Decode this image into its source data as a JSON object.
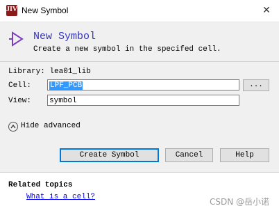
{
  "window": {
    "title": "New Symbol",
    "app_icon_text": "JIV",
    "close_glyph": "✕"
  },
  "header": {
    "icon": "symbol-triangle-icon",
    "title": "New Symbol",
    "subtitle": "Create a new symbol in the specifed cell."
  },
  "form": {
    "library_label": "Library:",
    "library_value": "lea01_lib",
    "cell_label": "Cell:",
    "cell_value": "LPF_PCB",
    "browse_label": "...",
    "view_label": "View:",
    "view_value": "symbol",
    "advanced_toggle": "Hide advanced"
  },
  "buttons": {
    "create": "Create Symbol",
    "cancel": "Cancel",
    "help": "Help"
  },
  "footer": {
    "related_title": "Related topics",
    "link": "What is a cell?",
    "watermark": "CSDN @岳小诺"
  },
  "colors": {
    "title_accent": "#3333cc",
    "icon_accent": "#7a3fc0",
    "selection": "#3399ff",
    "primary_border": "#0078d7"
  }
}
